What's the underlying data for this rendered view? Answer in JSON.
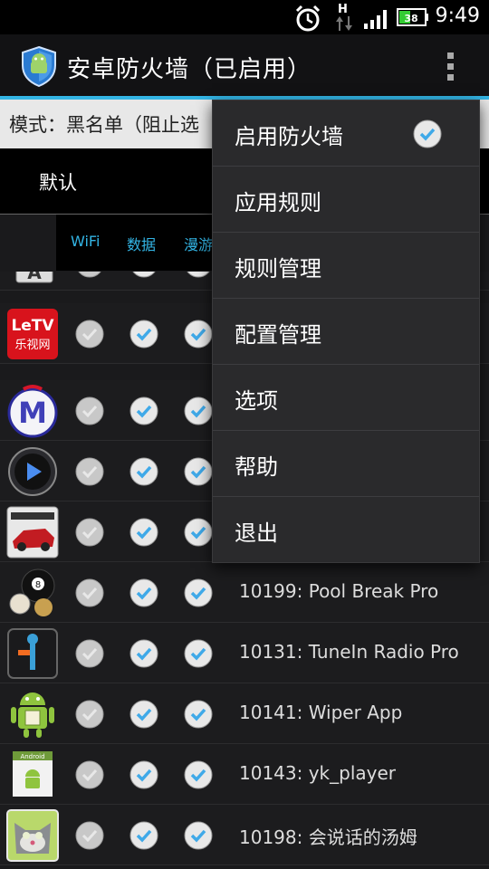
{
  "status_bar": {
    "time": "9:49",
    "battery_level": "38",
    "network": "H"
  },
  "action_bar": {
    "title": "安卓防火墙（已启用）"
  },
  "mode": {
    "text": "模式：黑名单（阻止选"
  },
  "profile": {
    "label": "默认"
  },
  "columns": [
    "WiFi",
    "数据",
    "漫游"
  ],
  "rows": [
    {
      "app": "",
      "icon": "font-a-icon",
      "wifi": false,
      "data": true,
      "roaming": true
    },
    {
      "app": "",
      "icon": "letv-icon",
      "wifi": false,
      "data": true,
      "roaming": true
    },
    {
      "app": "",
      "icon": "m-app-icon",
      "wifi": false,
      "data": true,
      "roaming": true
    },
    {
      "app": "",
      "icon": "media-player-icon",
      "wifi": false,
      "data": true,
      "roaming": true
    },
    {
      "app": "",
      "icon": "need-for-speed-icon",
      "wifi": false,
      "data": true,
      "roaming": true
    },
    {
      "app": "10199: Pool Break Pro",
      "icon": "billiard-icon",
      "wifi": false,
      "data": true,
      "roaming": true
    },
    {
      "app": "10131: TuneIn Radio Pro",
      "icon": "tunein-icon",
      "wifi": false,
      "data": true,
      "roaming": true
    },
    {
      "app": "10141: Wiper App",
      "icon": "android-package-icon",
      "wifi": false,
      "data": true,
      "roaming": true
    },
    {
      "app": "10143: yk_player",
      "icon": "android-app-icon",
      "wifi": false,
      "data": true,
      "roaming": true
    },
    {
      "app": "10198: 会说话的汤姆",
      "icon": "talking-tom-icon",
      "wifi": false,
      "data": true,
      "roaming": true
    }
  ],
  "menu": {
    "items": [
      {
        "label": "启用防火墙",
        "checked": true
      },
      {
        "label": "应用规则"
      },
      {
        "label": "规则管理"
      },
      {
        "label": "配置管理"
      },
      {
        "label": "选项"
      },
      {
        "label": "帮助"
      },
      {
        "label": "退出"
      }
    ]
  },
  "colors": {
    "accent": "#33b5e5",
    "check_blue": "#3fa9e8",
    "background": "#1a1a1c"
  }
}
